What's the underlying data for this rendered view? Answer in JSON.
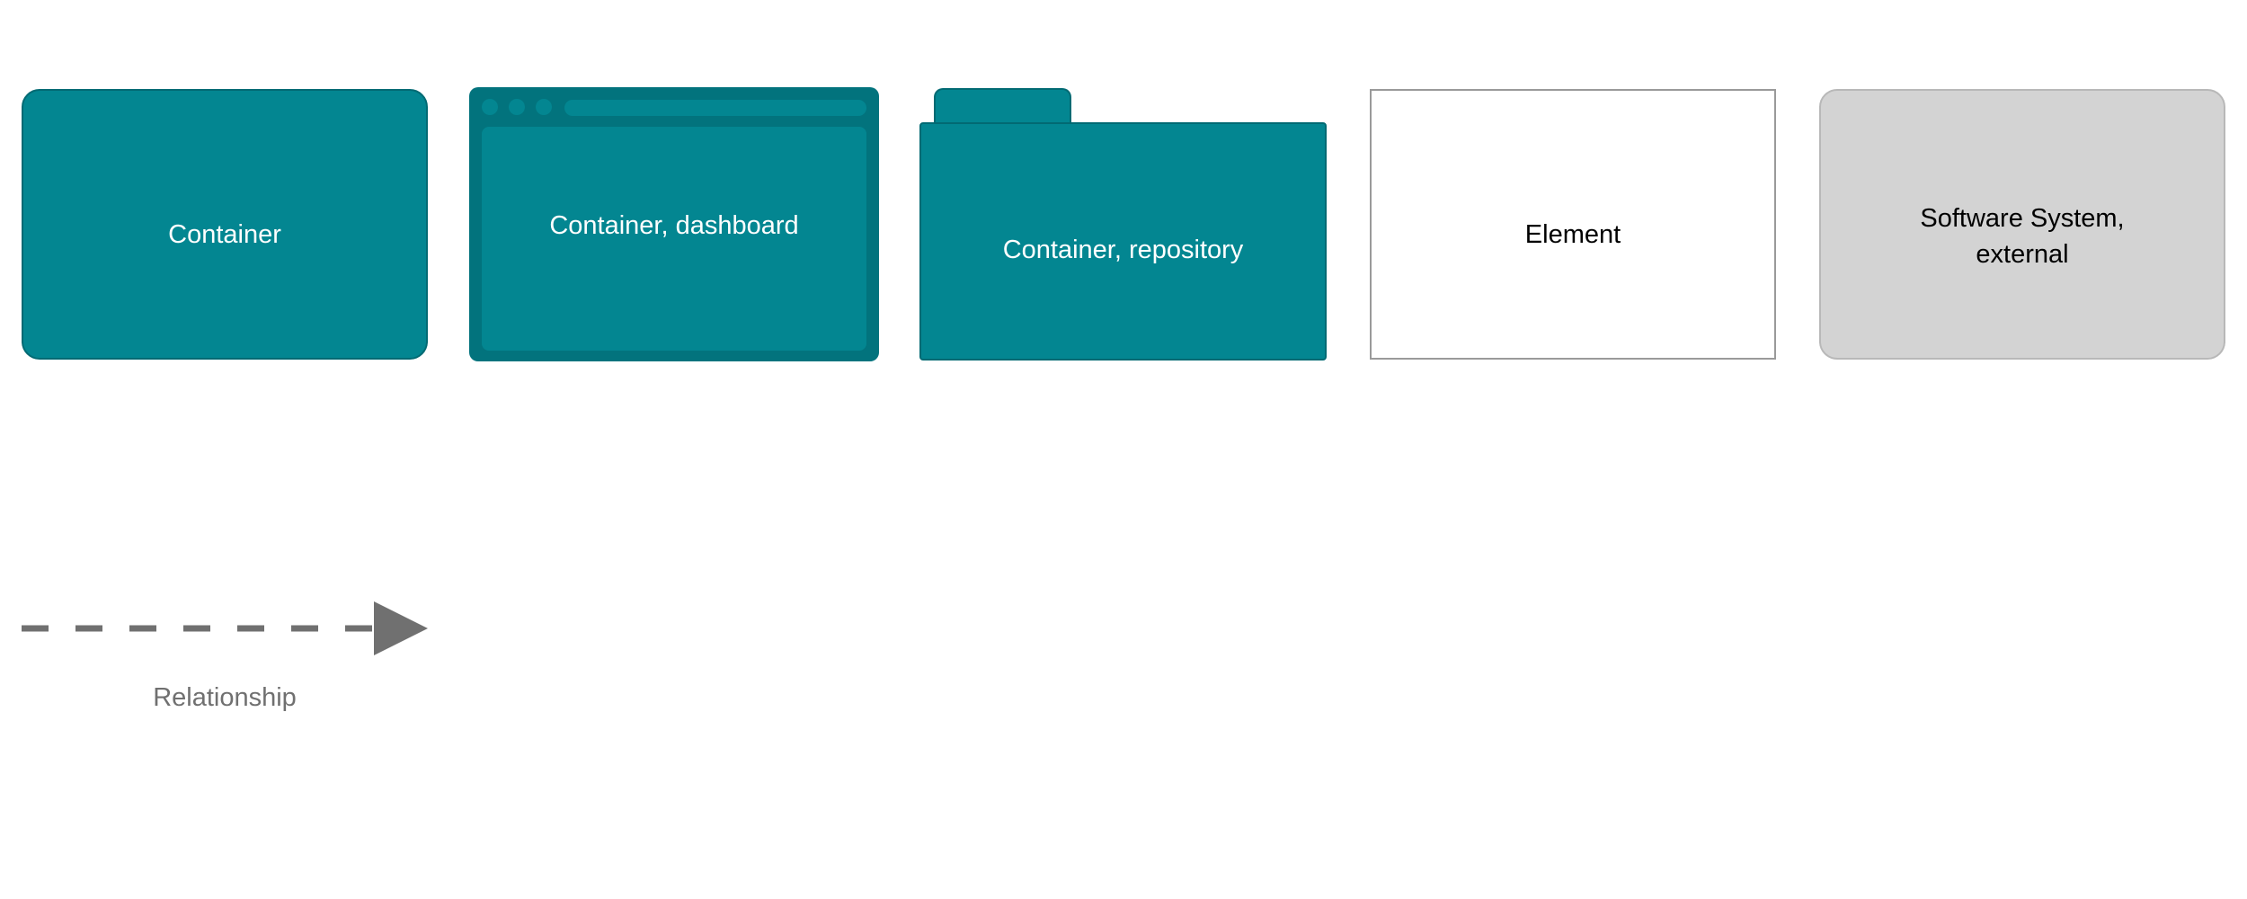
{
  "legend": {
    "elements": {
      "container": {
        "label": "Container"
      },
      "dashboard": {
        "label": "Container, dashboard"
      },
      "repository": {
        "label": "Container, repository"
      },
      "element": {
        "label": "Element"
      },
      "external": {
        "label": "Software System,\nexternal"
      }
    },
    "relationship": {
      "label": "Relationship"
    }
  },
  "colors": {
    "container_fill": "#038691",
    "container_border": "#026a73",
    "external_fill": "#d3d3d3",
    "element_border": "#9a9a9a",
    "relationship_line": "#707070"
  }
}
